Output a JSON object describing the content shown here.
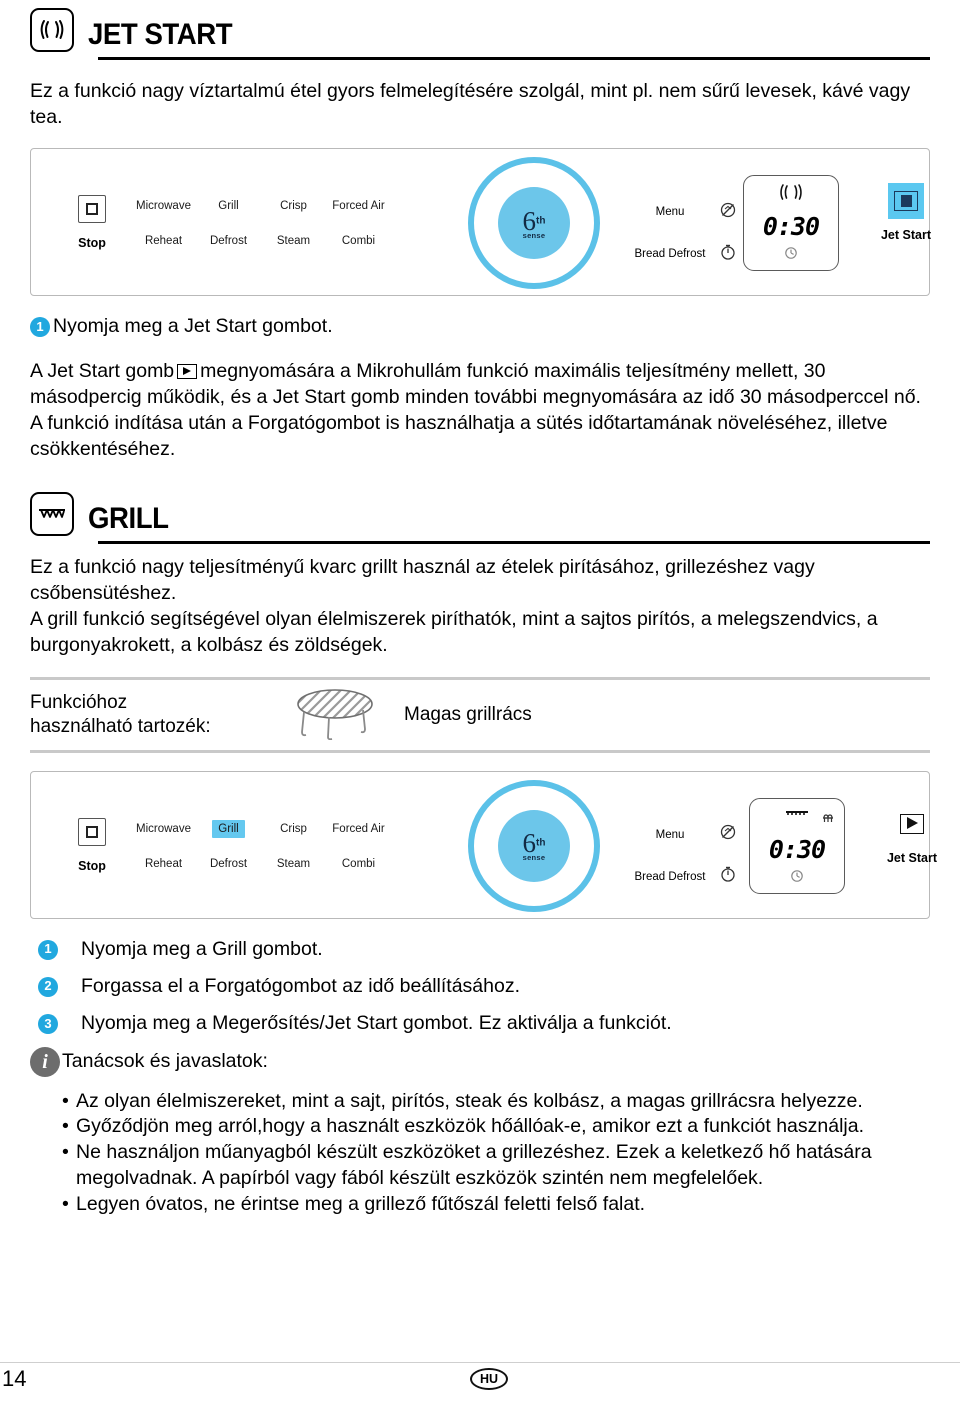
{
  "sections": {
    "jetstart": {
      "title": "JET START",
      "icon": "microwave-waves-icon",
      "intro": "Ez a funkció nagy víztartalmú étel gyors felmelegítésére szolgál, mint pl. nem sűrű levesek, kávé vagy tea.",
      "step1": "Nyomja meg a Jet Start gombot.",
      "para_a_pre": "A Jet Start gomb",
      "para_a_post": "megnyomására a Mikrohullám funkció maximális teljesítmény mellett, 30 másodpercig működik, és a Jet Start gomb minden további megnyomására az idő 30 másodperccel nő.",
      "para_b": "A funkció indítása után a Forgatógombot is használhatja a sütés időtartamának növeléséhez, illetve csökkentéséhez."
    },
    "grill": {
      "title": "GRILL",
      "icon": "grill-element-icon",
      "para_a": "Ez a funkció nagy teljesítményű kvarc grillt használ az ételek pirításához, grillezéshez vagy csőbensütéshez.",
      "para_b": "A grill funkció segítségével olyan élelmiszerek piríthatók, mint a sajtos pirítós, a melegszendvics, a burgonyakrokett, a kolbász és zöldségek.",
      "accessory_label_line1": "Funkcióhoz",
      "accessory_label_line2": "használható tartozék:",
      "accessory_name": "Magas grillrács",
      "steps": [
        "Nyomja meg a Grill gombot.",
        "Forgassa el a Forgatógombot az idő beállításához.",
        "Nyomja meg a Megerősítés/Jet Start gombot. Ez aktiválja a funkciót."
      ],
      "step_numbers": [
        "1",
        "2",
        "3"
      ],
      "tips_title": "Tanácsok és javaslatok:",
      "tips": [
        "Az olyan élelmiszereket, mint a sajt, pirítós, steak és kolbász, a magas grillrácsra helyezze.",
        "Győződjön meg arról,hogy a használt eszközök hőállóak-e, amikor ezt a funkciót használja.",
        "Ne használjon műanyagból készült eszközöket a grillezéshez. Ezek a keletkező hő hatására megolvadnak. A papírból vagy fából készült eszközök szintén nem megfelelőek.",
        "Legyen óvatos, ne érintse meg a grillező fűtőszál feletti felső falat."
      ]
    }
  },
  "panel": {
    "stop_label": "Stop",
    "modes_row1": [
      "Microwave",
      "Grill",
      "Crisp",
      "Forced Air"
    ],
    "modes_row2": [
      "Reheat",
      "Defrost",
      "Steam",
      "Combi"
    ],
    "knob_six": "6",
    "knob_th": "th",
    "knob_sense": "sense",
    "menu_label": "Menu",
    "bread_defrost_label": "Bread Defrost",
    "display_time": "0:30",
    "jet_start_label": "Jet Start"
  },
  "colors": {
    "accent_blue": "#5BC8F0",
    "knob_blue": "#6CC6EA",
    "badge_blue": "#21A8DF",
    "info_gray": "#6d6d6d"
  },
  "footer": {
    "page_number": "14",
    "language_badge": "HU"
  }
}
